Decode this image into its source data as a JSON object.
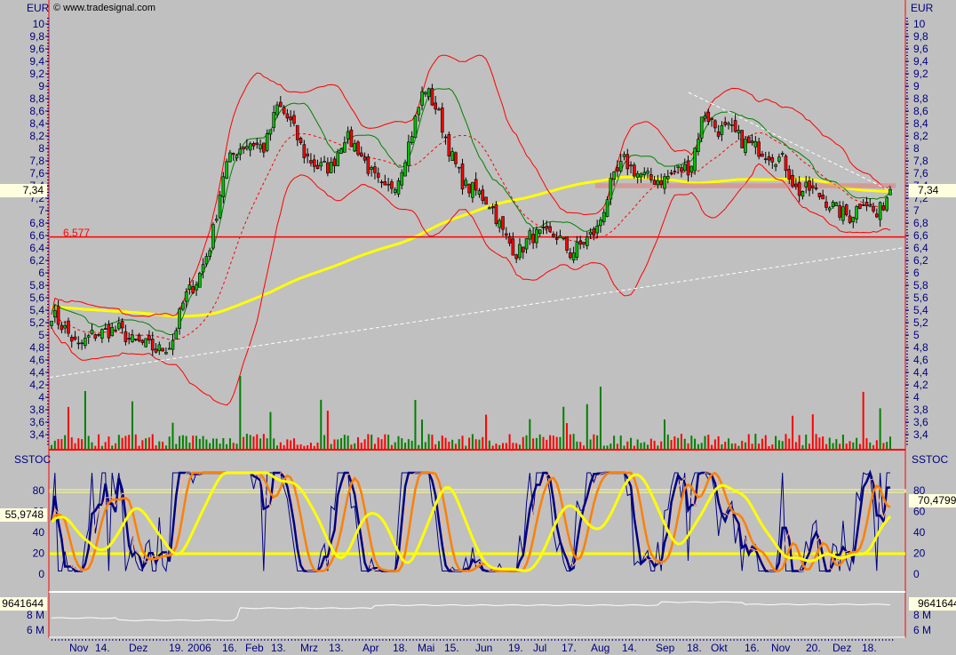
{
  "header": {
    "currency_left": "EUR",
    "currency_right": "EUR",
    "copyright": "© www.tradesignal.com"
  },
  "panes": {
    "stoch_title_left": "SSTOC",
    "stoch_title_right": "SSTOC",
    "last_price": "7,34",
    "stoch_left_value": "55,9748",
    "stoch_right_value": "70,4799",
    "bottom_value": "9641644",
    "support_label": "6,577"
  },
  "colors": {
    "background": "#c0c0c0",
    "axis_text": "#000080",
    "up": "#00c000",
    "down": "#ff0000",
    "bollinger": "#ff0000",
    "sma_long": "#ffff00",
    "green_line": "#008000",
    "stoch_fast": "#000080",
    "stoch_signal": "#ff8000",
    "stoch_slow": "#ffff00"
  },
  "chart_data": {
    "type": "candlestick",
    "price_axis": {
      "ylim": [
        3.2,
        10.1
      ],
      "ticks": [
        "10",
        "9,8",
        "9,6",
        "9,4",
        "9,2",
        "9",
        "8,8",
        "8,6",
        "8,4",
        "8,2",
        "8",
        "7,8",
        "7,6",
        "7,4",
        "7,2",
        "7",
        "6,8",
        "6,6",
        "6,4",
        "6,2",
        "6",
        "5,8",
        "5,6",
        "5,4",
        "5,2",
        "5",
        "4,8",
        "4,6",
        "4,4",
        "4,2",
        "4",
        "3,8",
        "3,6",
        "3,4"
      ]
    },
    "stoch_axis": {
      "ylim": [
        -10,
        100
      ],
      "ticks": [
        "80",
        "60",
        "40",
        "20",
        "0"
      ],
      "levels": [
        20,
        80
      ]
    },
    "bottom_axis": {
      "ticks": [
        "8 M",
        "6 M"
      ]
    },
    "x_ticks": [
      "Nov",
      "14.",
      "Dez",
      "19.",
      "2006",
      "16.",
      "Feb",
      "13.",
      "Mrz",
      "13.",
      "Apr",
      "18.",
      "Mai",
      "15.",
      "Jun",
      "19.",
      "Jul",
      "17.",
      "Aug",
      "14.",
      "Sep",
      "18.",
      "Okt",
      "16.",
      "Nov",
      "20.",
      "Dez",
      "18."
    ],
    "approx_closes": [
      5.35,
      5.1,
      4.8,
      5.0,
      5.05,
      5.1,
      4.9,
      4.85,
      4.75,
      4.85,
      5.6,
      5.9,
      6.5,
      7.7,
      8.0,
      8.1,
      8.0,
      8.7,
      8.4,
      7.9,
      7.7,
      7.7,
      8.2,
      8.0,
      7.6,
      7.3,
      7.5,
      8.2,
      9.0,
      8.6,
      7.9,
      7.4,
      7.3,
      7.1,
      6.6,
      6.3,
      6.6,
      6.6,
      6.6,
      6.3,
      6.5,
      6.7,
      7.4,
      7.8,
      7.6,
      7.5,
      7.5,
      7.65,
      7.7,
      8.6,
      8.3,
      8.3,
      8.1,
      8.0,
      7.9,
      7.8,
      7.3,
      7.35,
      7.2,
      7.0,
      6.9,
      7.2,
      6.9,
      7.34
    ],
    "support_level": 6.577,
    "resistance_zone": [
      7.36,
      7.44
    ],
    "last_close": 7.34,
    "bottom_last": 9641644
  }
}
